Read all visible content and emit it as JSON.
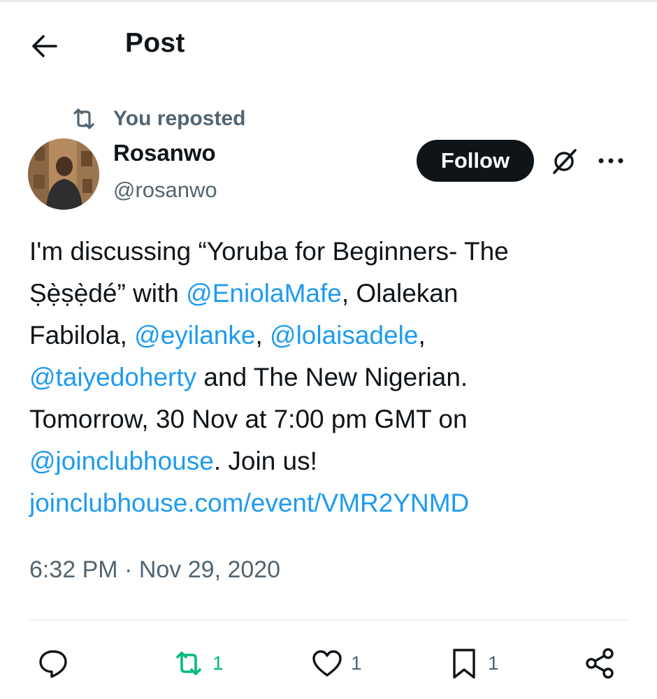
{
  "header": {
    "title": "Post",
    "back_icon": "arrow-left-icon"
  },
  "repost_banner": {
    "text": "You reposted",
    "icon": "repost-icon"
  },
  "author": {
    "name": "Rosanwo",
    "handle": "@rosanwo",
    "follow_label": "Follow"
  },
  "post": {
    "lines": [
      [
        {
          "t": "I'm discussing “Yoruba for Beginners- The",
          "link": false
        }
      ],
      [
        {
          "t": "Ṣẹ̀ṣẹ̀dé” with ",
          "link": false
        },
        {
          "t": "@EniolaMafe",
          "link": true
        },
        {
          "t": ", Olalekan",
          "link": false
        }
      ],
      [
        {
          "t": "Fabilola, ",
          "link": false
        },
        {
          "t": "@eyilanke",
          "link": true
        },
        {
          "t": ", ",
          "link": false
        },
        {
          "t": "@lolaisadele",
          "link": true
        },
        {
          "t": ",",
          "link": false
        }
      ],
      [
        {
          "t": "@taiyedoherty",
          "link": true
        },
        {
          "t": " and The New Nigerian.",
          "link": false
        }
      ],
      [
        {
          "t": "Tomorrow, 30 Nov at 7:00 pm GMT on",
          "link": false
        }
      ],
      [
        {
          "t": "@joinclubhouse",
          "link": true
        },
        {
          "t": ". Join us!",
          "link": false
        }
      ],
      [
        {
          "t": "joinclubhouse.com/event/VMR2YNMD",
          "link": true
        }
      ]
    ],
    "timestamp": "6:32 PM · Nov 29, 2020"
  },
  "actions": {
    "reply": {
      "count": ""
    },
    "repost": {
      "count": "1"
    },
    "like": {
      "count": "1"
    },
    "bookmark": {
      "count": "1"
    },
    "share": {
      "count": ""
    }
  },
  "colors": {
    "link": "#1d9bf0",
    "text": "#0f1419",
    "secondary": "#536471",
    "repost_active": "#00ba7c",
    "follow_bg": "#0f1419"
  }
}
